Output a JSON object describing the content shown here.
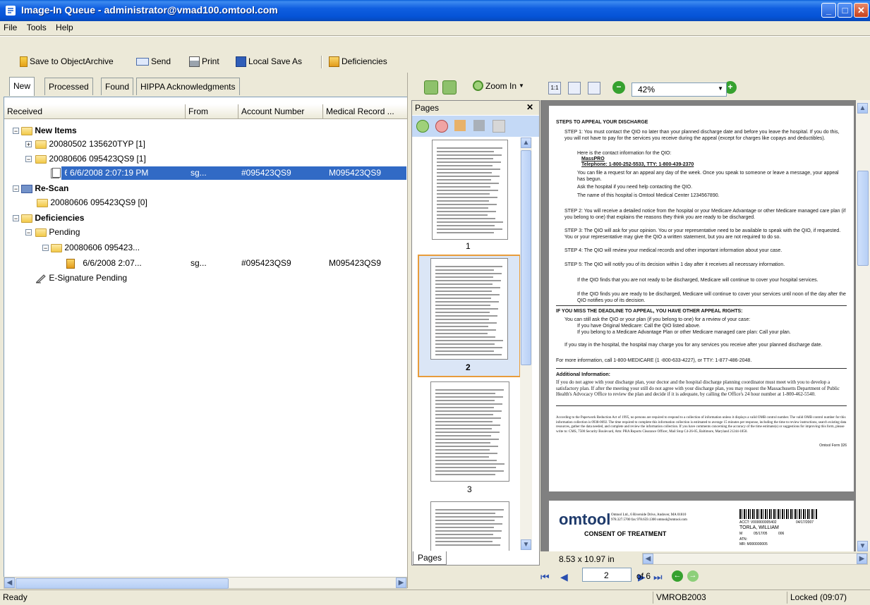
{
  "window": {
    "title": "Image-In Queue - administrator@vmad100.omtool.com"
  },
  "menu": [
    "File",
    "Tools",
    "Help"
  ],
  "toolbar": {
    "save_archive": "Save to ObjectArchive",
    "send": "Send",
    "print": "Print",
    "local_save": "Local Save As",
    "deficiencies": "Deficiencies"
  },
  "tabs": [
    "New",
    "Processed",
    "Found",
    "HIPPA Acknowledgments"
  ],
  "columns": [
    "Received",
    "From",
    "Account Number",
    "Medical Record ..."
  ],
  "tree": {
    "new_items": "New Items",
    "batch1": "20080502 135620TYP  [1]",
    "batch2": "20080606 095423QS9  [1]",
    "sel_received": "6/6/2008 2:07:19 PM",
    "sel_from": "sg...",
    "sel_account": "#095423QS9",
    "sel_mrn": "M095423QS9",
    "rescan": "Re-Scan",
    "rescan_batch": "20080606 095423QS9  [0]",
    "deficiencies": "Deficiencies",
    "pending": "Pending",
    "pend_batch": "20080606 095423...",
    "pend_received": "6/6/2008 2:07...",
    "pend_from": "sg...",
    "pend_account": "#095423QS9",
    "pend_mrn": "M095423QS9",
    "esig": "E-Signature Pending"
  },
  "viewer": {
    "zoom_in": "Zoom In",
    "zoom_value": "42%",
    "pages_title": "Pages",
    "pages_tab": "Pages",
    "thumb_labels": [
      "1",
      "2",
      "3"
    ],
    "page_size": "8.53 x 10.97 in",
    "current_page": "2",
    "of_pages": "of 6"
  },
  "document": {
    "heading": "STEPS TO APPEAL YOUR DISCHARGE",
    "step1": "STEP 1: You must contact the QIO no later than your planned discharge date and before you leave the hospital. If you do this, you will not have to pay for the services you receive during the appeal (except for charges like copays and deductibles).",
    "contact": "Here is the contact information for the QIO:",
    "qio_name": "MassPRO",
    "qio_phone": "Telephone: 1-800-252-5533,  TTY: 1-800-439-2370",
    "file_request": "You can file a request for an appeal any day of the week. Once you speak to someone or leave a message, your appeal has begun.",
    "ask": "Ask the hospital if you need help contacting the QIO.",
    "hospital": "The name of this hospital is Omtool Medical Center  1234567890.",
    "step2": "STEP 2: You will receive a detailed notice from the hospital or your Medicare Advantage or other Medicare managed care plan (if you belong to one) that explains the reasons they think you are ready to be discharged.",
    "step3": "STEP 3: The QIO will ask for your opinion. You or your representative need to be available to speak with the QIO, if requested. You or your representative may give the QIO a written statement, but you are not required to do so.",
    "step4": "STEP 4: The QIO will review your medical records and other important information about your case.",
    "step5": "STEP 5: The QIO will notify you of its decision within 1 day after it receives all necessary information.",
    "finds_not": "If the QIO finds that you are not ready to be discharged, Medicare will continue to cover your hospital services.",
    "finds_ready": "If the QIO finds you are ready to be discharged, Medicare will continue to cover your services until noon of the day after the QIO notifies you of its decision.",
    "deadline_heading": "IF YOU MISS THE DEADLINE TO APPEAL, YOU HAVE OTHER APPEAL RIGHTS:",
    "still_ask": "You can still ask the QIO or your plan (if you belong to one) for a review of your case:",
    "original": "If you have Original Medicare: Call the QIO listed above.",
    "advantage": "If you belong to a Medicare Advantage Plan or other Medicare managed care plan: Call your plan.",
    "stay": "If you stay in the hospital, the hospital may charge you for any services you receive after your planned discharge date.",
    "more_info": "For more information, call 1-800-MEDICARE (1 -800-633-4227), or TTY: 1-877-486-2048.",
    "additional_heading": "Additional Information:",
    "additional": "If you do not agree with your discharge plan, your doctor and the hospital discharge planning coordinator must meet with you to develop a satisfactory plan. If after the meeting your still do not agree with your discharge plan, you may request the Massachusetts Department of Public Health's Advocacy Office to review the plan and decide if it is adequate, by calling the Office's 24 hour number at 1-800-462-5540.",
    "paperwork": "According to the Paperwork Reduction Act of 1995, no persons are required to respond to a collection of information unless it displays a valid OMB control number. The valid OMB control number for this information collection is 0938-0692. The time required to complete this information collection is estimated to average 15 minutes per response, including the time to review instructions, search existing data resources, gather the data needed, and complete and review the information collection. If you have comments concerning the accuracy of the time estimate(s) or suggestions for improving this form, please write to: CMS, 7500 Security Boulevard, Attn: PRA Reports Clearance Officer, Mail Stop C4-26-05, Baltimore, Maryland 21244-1850.",
    "form_no": "Omtool Form 326",
    "p2_logo": "omtool",
    "p2_address": "Omtool Ltd., 6 Riverside Drive, Andover, MA 01810",
    "p2_phone": "978.327.5700    fax 978.659.1300    omtool@omtool.com",
    "p2_title": "CONSENT OF TREATMENT",
    "p2_acct": "ACCT: V000000005402",
    "p2_date": "04/17/2007",
    "p2_name": "TORLA, WILLIAM",
    "p2_m": "M",
    "p2_dob": "05/17/05",
    "p2_age": "006",
    "p2_atn": "ATN:",
    "p2_mr": "MR: M000000005"
  },
  "status": {
    "left": "Ready",
    "machine": "VMROB2003",
    "lock": "Locked (09:07)"
  }
}
